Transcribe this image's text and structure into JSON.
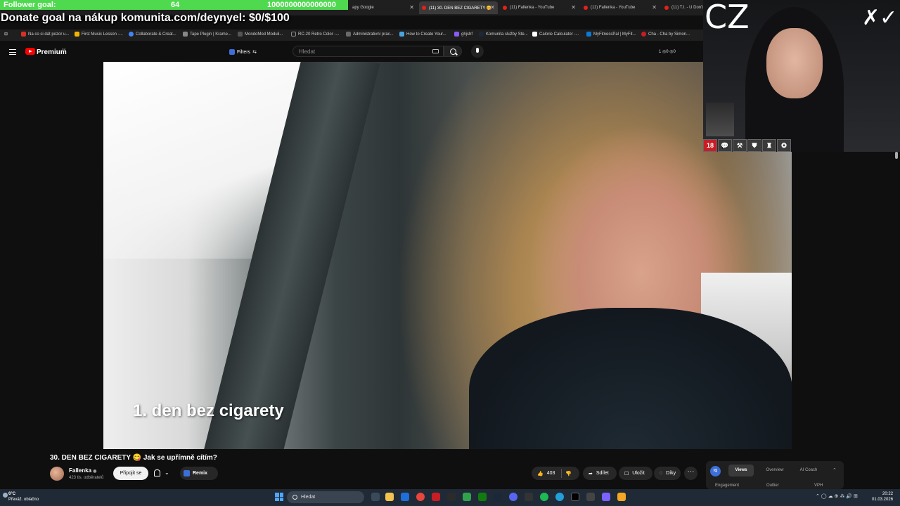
{
  "browser": {
    "tabs": [
      {
        "label": "apy Google",
        "active": false
      },
      {
        "label": "(11) 30. DEN BEZ CIGARETY 😋",
        "active": true
      },
      {
        "label": "(11) Fallenka - YouTube",
        "active": false
      },
      {
        "label": "(11) Fallenka - YouTube",
        "active": false
      },
      {
        "label": "(11) T.I. - U Don't",
        "active": false
      }
    ],
    "bookmarks": [
      "Na co si dát pozor u...",
      "First Music Lesson -...",
      "Collaborate & Creat...",
      "Tape Plugin | Krame...",
      "MondoMod Moduli...",
      "RC-20 Retro Color -...",
      "Administrativní prac...",
      "How to Create Your...",
      "ghjshf",
      "Komunita služby Ste...",
      "Calorie Calculator -...",
      "MyFitnessPal | MyFit...",
      "Cha - Cha by Simon..."
    ]
  },
  "overlay": {
    "follower_goal_label": "Follower goal:",
    "follower_goal_current": "64",
    "follower_goal_target": "1000000000000000",
    "follower_goal_fill_fraction": 0.0,
    "donate_text": "Donate goal na nákup komunita.com/deynyel: $0/$100"
  },
  "youtube": {
    "brand": "Premium",
    "brand_region": "CZ",
    "filters_label": "Filters",
    "search_placeholder": "Hledat",
    "stats": "1 ◎0 ◎0",
    "video_subtitle": "1. den bez cigarety",
    "video_title": "30. DEN BEZ CIGARETY 😋 Jak se upřímně cítím?",
    "channel_name": "Fallenka",
    "channel_subs": "423 tis. odběratelů",
    "subscribe_label": "Připojit se",
    "remix_label": "Remix",
    "like_count": "403",
    "share_label": "Sdílet",
    "save_label": "Uložit",
    "thanks_label": "Díky",
    "more_label": "⋯"
  },
  "analytics_panel": {
    "logo": "IQ",
    "tabs": [
      "Views",
      "Overview",
      "AI Coach"
    ],
    "active_tab": "Views",
    "sub_labels": [
      "Engagement",
      "Outlier",
      "VPH"
    ]
  },
  "webcam": {
    "overlay_text": "CZ",
    "signature": "✗✓",
    "badges": [
      "18",
      "💬",
      "⚒",
      "⛊",
      "♜",
      "✪"
    ]
  },
  "taskbar": {
    "weather_temp": "6°C",
    "weather_desc": "Převáž. oblačno",
    "search_placeholder": "Hledat",
    "tray": "⌃  ◯ ☁ ⊕ ⁂ 🔊 ⊞",
    "time": "20:22",
    "date": "01.03.2026"
  },
  "colors": {
    "goal_bar": "#4fd94f",
    "youtube_red": "#ff0000",
    "accent_blue": "#3d6fd9",
    "background": "#0f0f0f"
  }
}
